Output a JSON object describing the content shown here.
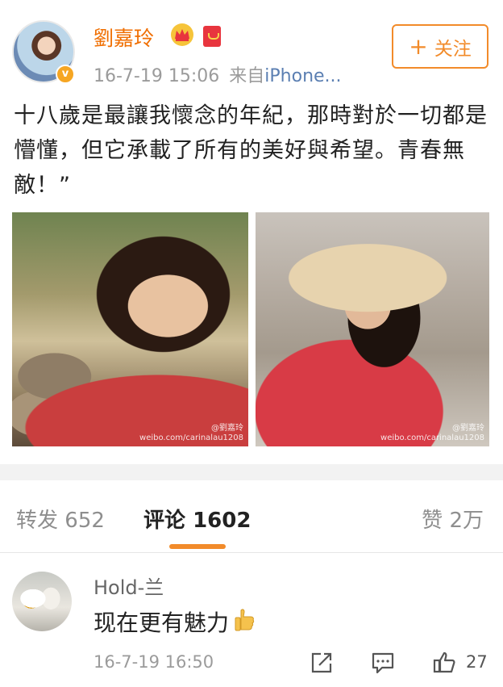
{
  "post": {
    "username": "劉嘉玲",
    "timestamp": "16-7-19 15:06",
    "source_prefix": "来自",
    "source_device": "iPhone...",
    "follow_label": "关注",
    "follow_plus": "+",
    "verified_badge": "v",
    "text": "十八歲是最讓我懷念的年紀，那時對於一切都是懵懂，但它承載了所有的美好與希望。青春無敵！”",
    "photos": [
      {
        "watermark_line1": "@劉嘉玲",
        "watermark_line2": "weibo.com/carinalau1208"
      },
      {
        "watermark_line1": "@劉嘉玲",
        "watermark_line2": "weibo.com/carinalau1208"
      }
    ],
    "icons": [
      "crown-icon",
      "red-packet-icon",
      "verified-icon"
    ],
    "accent_color": "#f28b2a",
    "name_color": "#f06e00"
  },
  "tabs": {
    "repost_label": "转发",
    "repost_count": "652",
    "comments_label": "评论",
    "comments_count": "1602",
    "likes_label": "赞",
    "likes_count": "2万"
  },
  "comment": {
    "username": "Hold-兰",
    "text": "现在更有魅力",
    "timestamp": "16-7-19 16:50",
    "like_count": "27",
    "icons": [
      "thumbs-up-emoji",
      "share-icon",
      "reply-icon",
      "like-icon"
    ]
  }
}
